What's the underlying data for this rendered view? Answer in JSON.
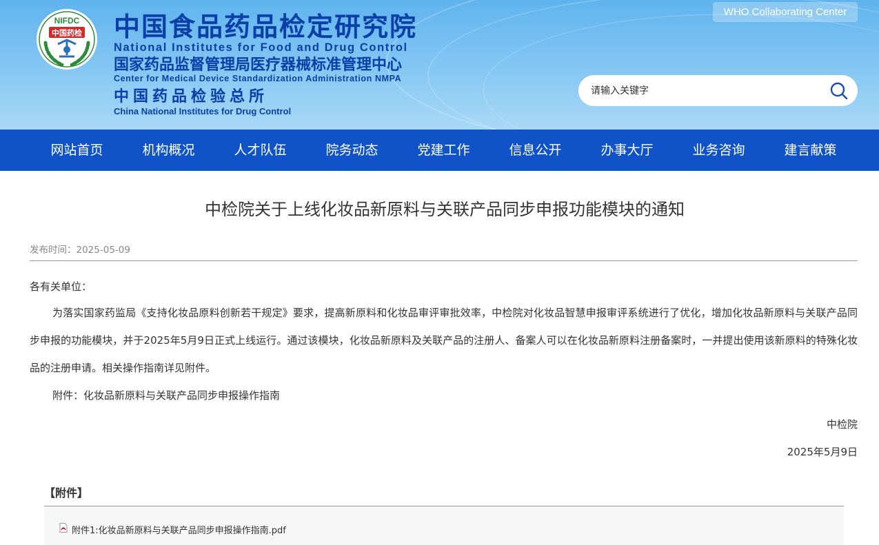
{
  "header": {
    "logo_text_top": "NIFDC",
    "logo_text_mid": "中国药检",
    "title_cn": "中国食品药品检定研究院",
    "title_en": "National Institutes for Food and Drug Control",
    "subtitle_cn": "国家药品监督管理局医疗器械标准管理中心",
    "subtitle_en": "Center for Medical Device Standardization Administration NMPA",
    "third_cn": "中国药品检验总所",
    "third_en": "China National Institutes for Drug Control",
    "who_label": "WHO Collaborating Center",
    "search_placeholder": "请输入关键字"
  },
  "nav": {
    "items": [
      "网站首页",
      "机构概况",
      "人才队伍",
      "院务动态",
      "党建工作",
      "信息公开",
      "办事大厅",
      "业务咨询",
      "建言献策"
    ]
  },
  "article": {
    "title": "中检院关于上线化妆品新原料与关联产品同步申报功能模块的通知",
    "publish_time": "发布时间：2025-05-09",
    "salutation": "各有关单位：",
    "paragraph": "为落实国家药监局《支持化妆品原料创新若干规定》要求，提高新原料和化妆品审评审批效率，中检院对化妆品智慧申报审评系统进行了优化，增加化妆品新原料与关联产品同步申报的功能模块，并于2025年5月9日正式上线运行。通过该模块，化妆品新原料及关联产品的注册人、备案人可以在化妆品新原料注册备案时，一并提出使用该新原料的特殊化妆品的注册申请。相关操作指南详见附件。",
    "attachment_line": "附件：化妆品新原料与关联产品同步申报操作指南",
    "signature": "中检院",
    "date": "2025年5月9日"
  },
  "attachments": {
    "header": "【附件】",
    "items": [
      "附件1:化妆品新原料与关联产品同步申报操作指南.pdf"
    ]
  },
  "colors": {
    "nav_bg": "#1053c8",
    "title_blue": "#0a3fa8",
    "logo_green": "#2e8b3a",
    "logo_red": "#d42a2a"
  },
  "icons": {
    "search": "search-icon",
    "logo": "nifdc-logo",
    "pdf": "pdf-icon"
  }
}
